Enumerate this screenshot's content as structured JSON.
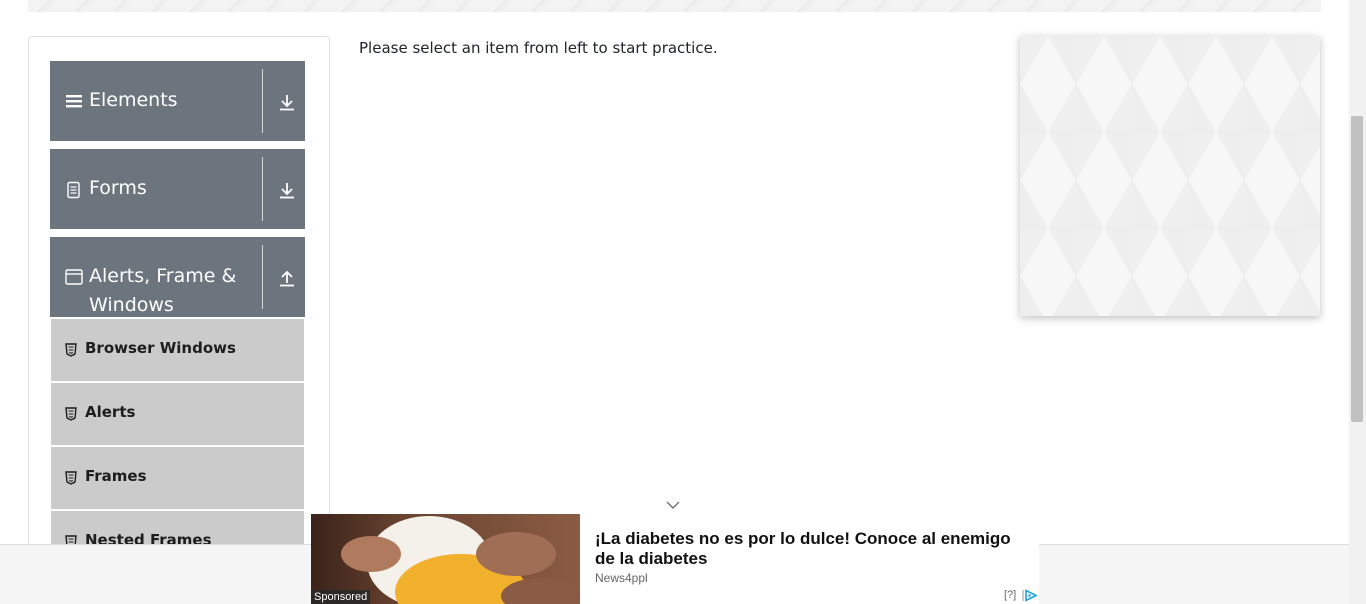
{
  "colors": {
    "group_header_bg": "#6c757d",
    "submenu_bg": "#cbcbcb",
    "adchoices_blue": "#1ea0e1"
  },
  "sidebar": {
    "groups": [
      {
        "label": "Elements",
        "icon": "hamburger-icon",
        "toggle_icon": "arrow-down-icon",
        "expanded": false
      },
      {
        "label": "Forms",
        "icon": "document-icon",
        "toggle_icon": "arrow-down-icon",
        "expanded": false
      },
      {
        "label": "Alerts, Frame & Windows",
        "icon": "window-icon",
        "toggle_icon": "arrow-up-icon",
        "expanded": true
      }
    ],
    "items": [
      {
        "label": "Browser Windows",
        "icon": "html5-icon"
      },
      {
        "label": "Alerts",
        "icon": "html5-icon"
      },
      {
        "label": "Frames",
        "icon": "html5-icon"
      },
      {
        "label": "Nested Frames",
        "icon": "html5-icon"
      }
    ]
  },
  "main": {
    "prompt": "Please select an item from left to start practice."
  },
  "bottom_ad": {
    "headline": "¡La diabetes no es por lo dulce! Conoce al enemigo de la diabetes",
    "source": "News4ppl",
    "sponsored_label": "Sponsored",
    "report_label": "[?]"
  }
}
